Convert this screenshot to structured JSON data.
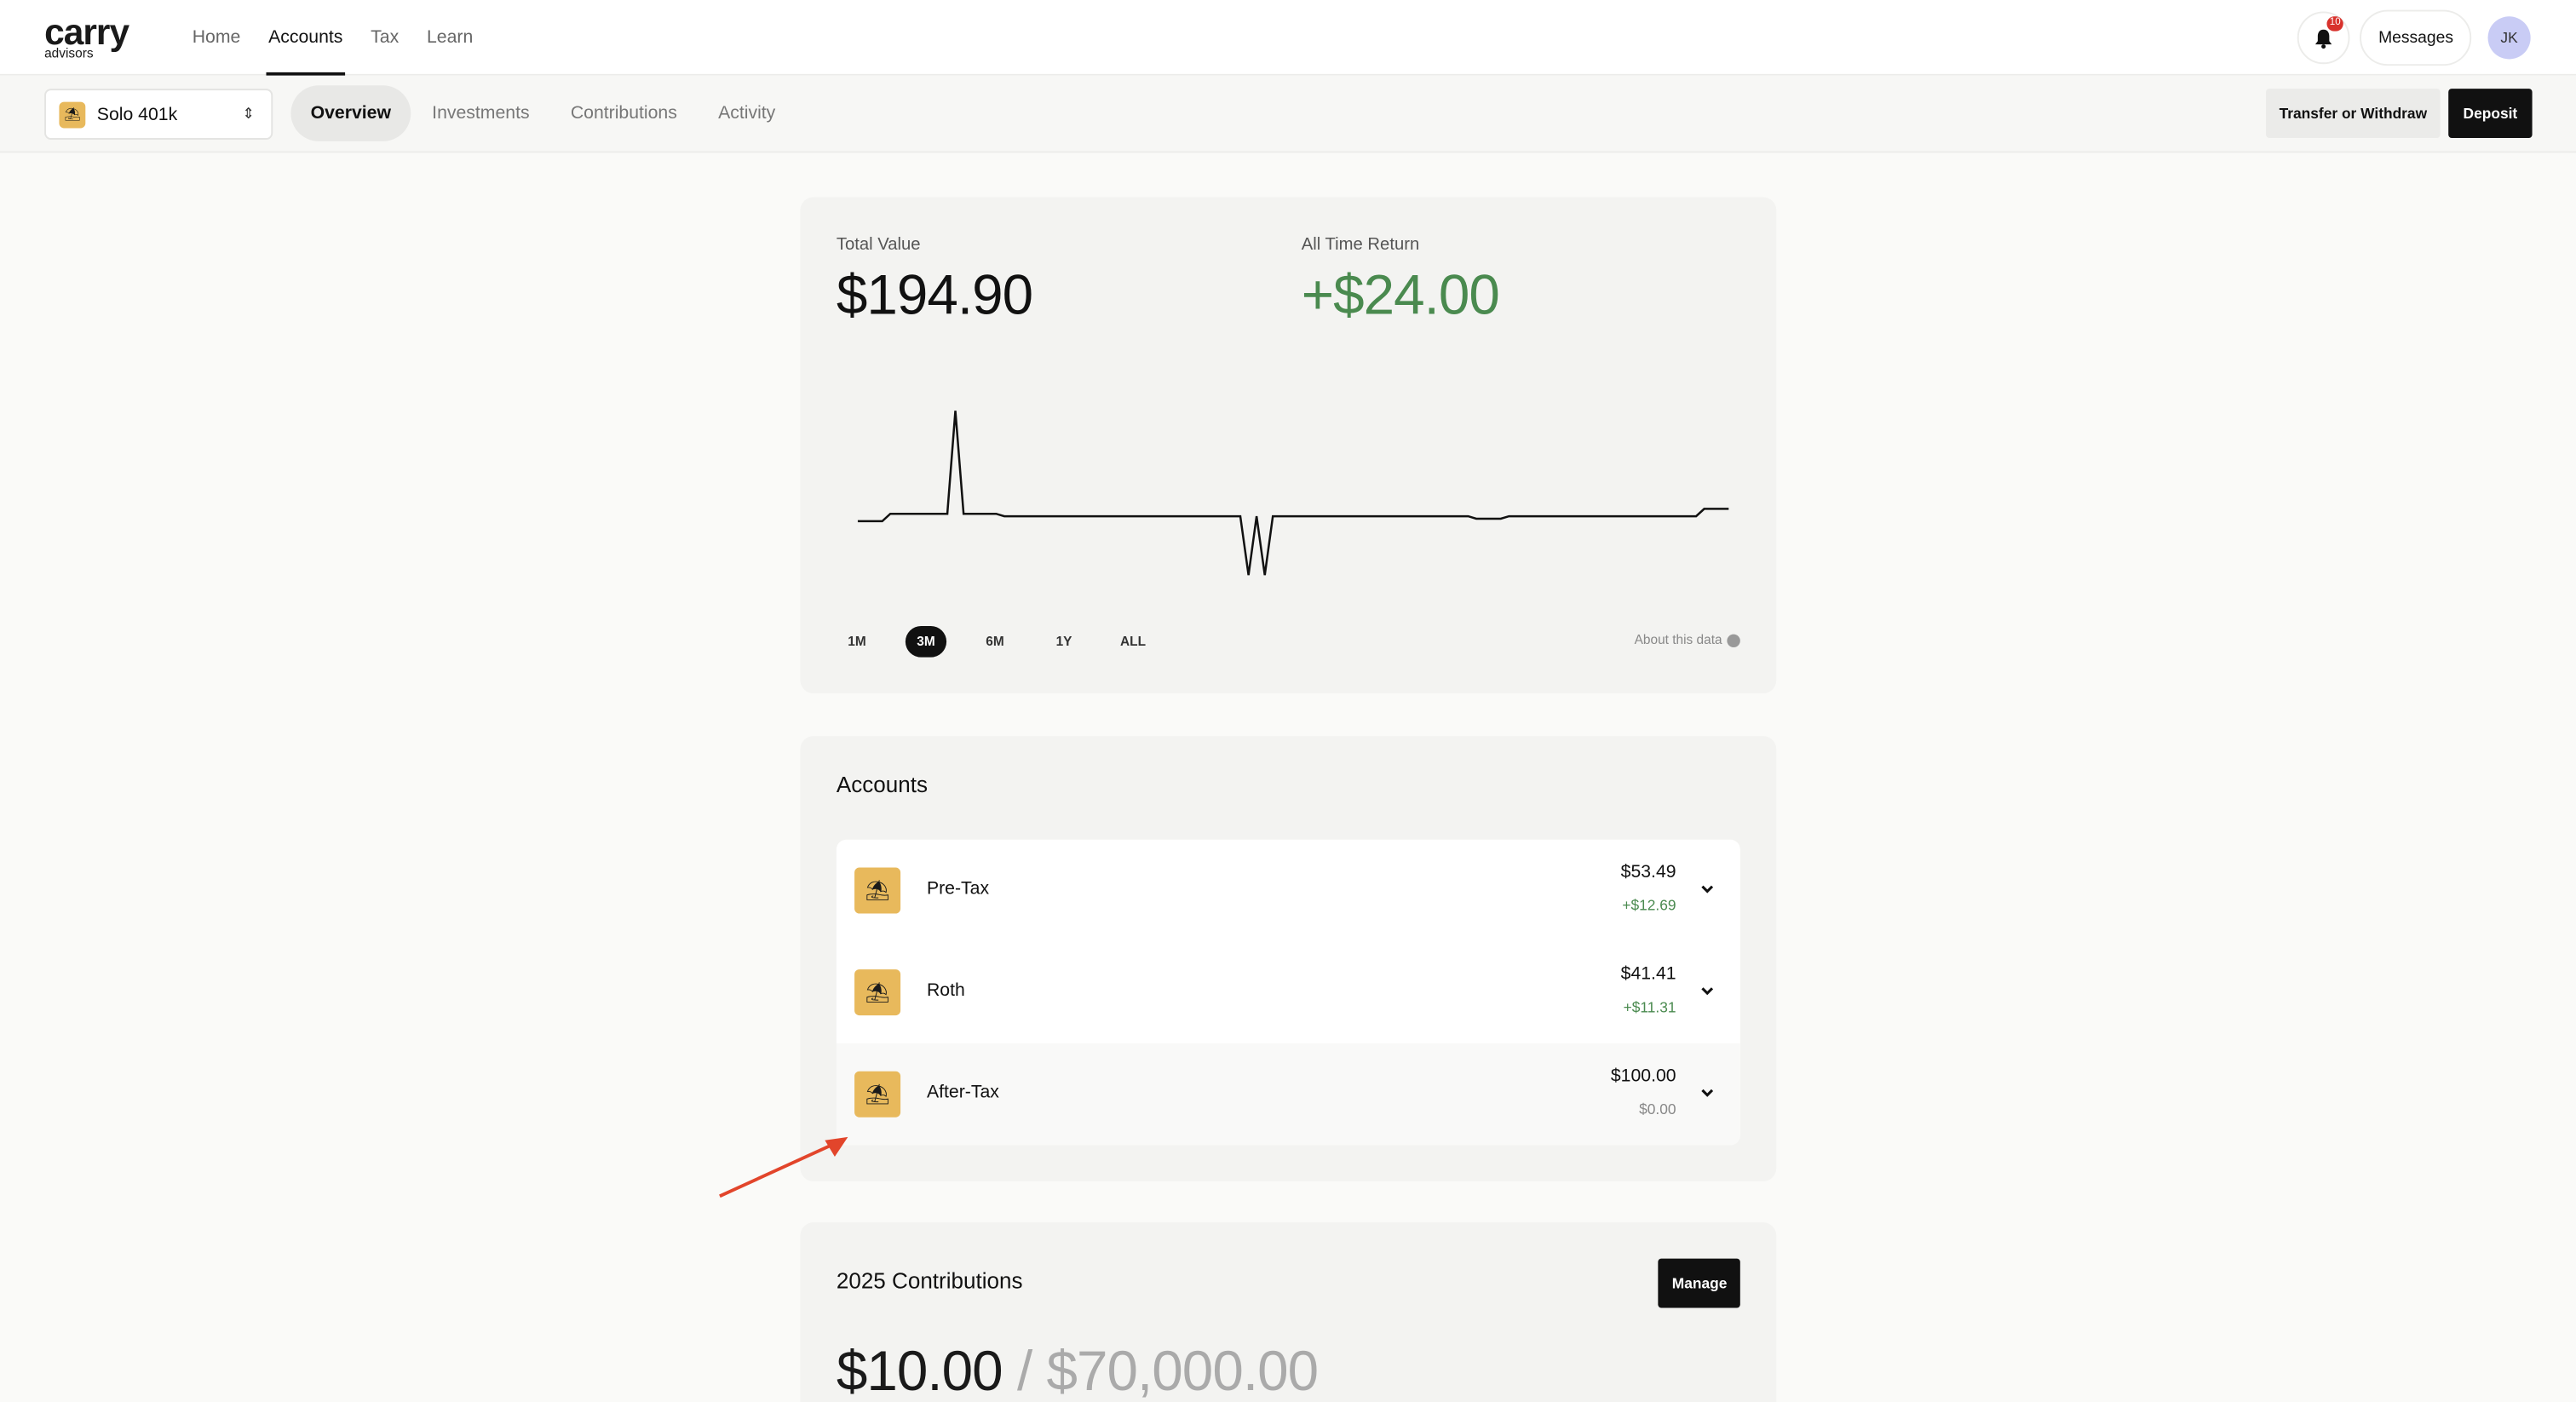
{
  "brand": {
    "name": "carry",
    "sub": "advisors"
  },
  "nav": {
    "items": [
      "Home",
      "Accounts",
      "Tax",
      "Learn"
    ],
    "active": "Accounts"
  },
  "header": {
    "notifications_count": "10",
    "messages_label": "Messages",
    "avatar_initials": "JK"
  },
  "account_selector": {
    "label": "Solo 401k",
    "icon": "umbrella-beach-icon"
  },
  "tabs": {
    "items": [
      "Overview",
      "Investments",
      "Contributions",
      "Activity"
    ],
    "active": "Overview"
  },
  "actions": {
    "transfer_label": "Transfer or Withdraw",
    "deposit_label": "Deposit"
  },
  "overview": {
    "total_value_label": "Total Value",
    "total_value": "$194.90",
    "all_time_return_label": "All Time Return",
    "all_time_return": "+$24.00",
    "ranges": [
      "1M",
      "3M",
      "6M",
      "1Y",
      "ALL"
    ],
    "active_range": "3M",
    "about_label": "About this data"
  },
  "chart_data": {
    "type": "line",
    "series": [
      {
        "values": [
          0.0,
          0.0,
          0.0,
          0.0,
          0.3,
          0.3,
          0.3,
          0.3,
          0.3,
          0.3,
          0.3,
          0.3,
          4.5,
          0.3,
          0.3,
          0.3,
          0.3,
          0.3,
          0.2,
          0.2,
          0.2,
          0.2,
          0.2,
          0.2,
          0.2,
          0.2,
          0.2,
          0.2,
          0.2,
          0.2,
          0.2,
          0.2,
          0.2,
          0.2,
          0.2,
          0.2,
          0.2,
          0.2,
          0.2,
          0.2,
          0.2,
          0.2,
          0.2,
          0.2,
          0.2,
          0.2,
          0.2,
          0.2,
          -2.2,
          0.2,
          -2.2,
          0.2,
          0.2,
          0.2,
          0.2,
          0.2,
          0.2,
          0.2,
          0.2,
          0.2,
          0.2,
          0.2,
          0.2,
          0.2,
          0.2,
          0.2,
          0.2,
          0.2,
          0.2,
          0.2,
          0.2,
          0.2,
          0.2,
          0.2,
          0.2,
          0.2,
          0.1,
          0.1,
          0.1,
          0.1,
          0.2,
          0.2,
          0.2,
          0.2,
          0.2,
          0.2,
          0.2,
          0.2,
          0.2,
          0.2,
          0.2,
          0.2,
          0.2,
          0.2,
          0.2,
          0.2,
          0.2,
          0.2,
          0.2,
          0.2,
          0.2,
          0.2,
          0.2,
          0.2,
          0.5,
          0.5,
          0.5,
          0.5
        ]
      }
    ],
    "grid": false,
    "legend": "none"
  },
  "accounts": {
    "title": "Accounts",
    "rows": [
      {
        "name": "Pre-Tax",
        "balance": "$53.49",
        "change": "+$12.69",
        "change_type": "gain"
      },
      {
        "name": "Roth",
        "balance": "$41.41",
        "change": "+$11.31",
        "change_type": "gain"
      },
      {
        "name": "After-Tax",
        "balance": "$100.00",
        "change": "$0.00",
        "change_type": "zero"
      }
    ]
  },
  "contributions": {
    "title": "2025 Contributions",
    "manage_label": "Manage",
    "amount": "$10.00",
    "separator": "/",
    "limit": "$70,000.00"
  },
  "colors": {
    "gain": "#4a8a4f",
    "accent_icon": "#e8b95c",
    "annotation_arrow": "#e2452b"
  }
}
